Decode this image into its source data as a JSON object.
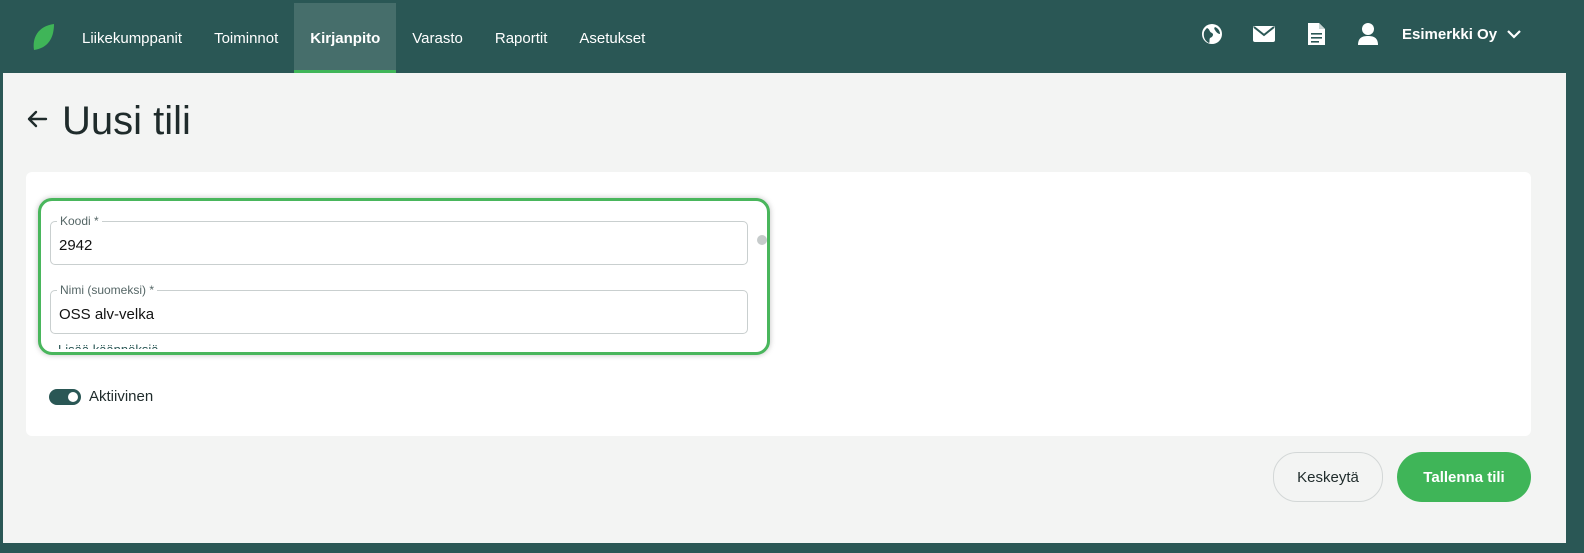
{
  "nav": {
    "items": [
      {
        "label": "Liikekumppanit"
      },
      {
        "label": "Toiminnot"
      },
      {
        "label": "Kirjanpito",
        "active": true
      },
      {
        "label": "Varasto"
      },
      {
        "label": "Raportit"
      },
      {
        "label": "Asetukset"
      }
    ]
  },
  "header": {
    "company": "Esimerkki Oy",
    "icons": [
      "globe-icon",
      "mail-icon",
      "document-icon",
      "user-icon"
    ]
  },
  "page": {
    "title": "Uusi tili"
  },
  "form": {
    "code": {
      "label": "Koodi *",
      "value": "2942"
    },
    "name": {
      "label": "Nimi (suomeksi) *",
      "value": "OSS alv-velka"
    },
    "translations_link": "Lisää käännöksiä",
    "active": {
      "label": "Aktiivinen",
      "checked": true
    }
  },
  "actions": {
    "cancel": "Keskeytä",
    "save": "Tallenna tili"
  },
  "colors": {
    "topbar": "#2a5755",
    "accent": "#3fb558",
    "active_nav": "#466e6b"
  }
}
